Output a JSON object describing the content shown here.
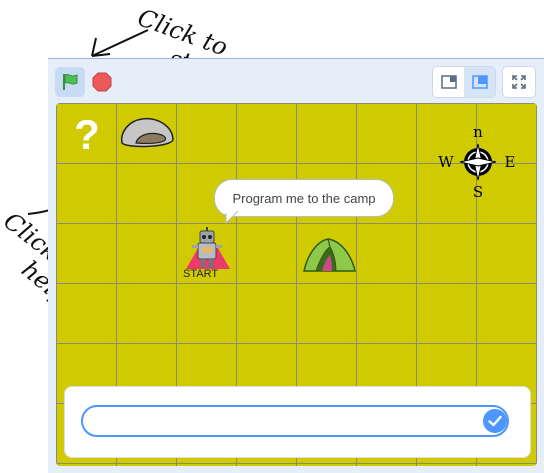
{
  "annotations": {
    "start_hint": [
      "Click to",
      "start"
    ],
    "help_hint": [
      "Click for",
      "help"
    ]
  },
  "toolbar": {
    "green_flag": "green-flag-icon",
    "stop": "stop-sign-icon",
    "small_stage": "small-stage-icon",
    "normal_stage": "normal-stage-icon",
    "fullscreen": "fullscreen-icon"
  },
  "stage": {
    "speech_bubble": "Program me to the camp",
    "start_label": "START",
    "compass": {
      "n": "n",
      "s": "S",
      "e": "E",
      "w": "W"
    },
    "help_symbol": "?"
  },
  "ask": {
    "value": "",
    "placeholder": ""
  },
  "colors": {
    "stage_bg": "#cfcb00",
    "accent": "#4c97ff",
    "flag": "#4cbf56",
    "stop": "#ec5959"
  }
}
